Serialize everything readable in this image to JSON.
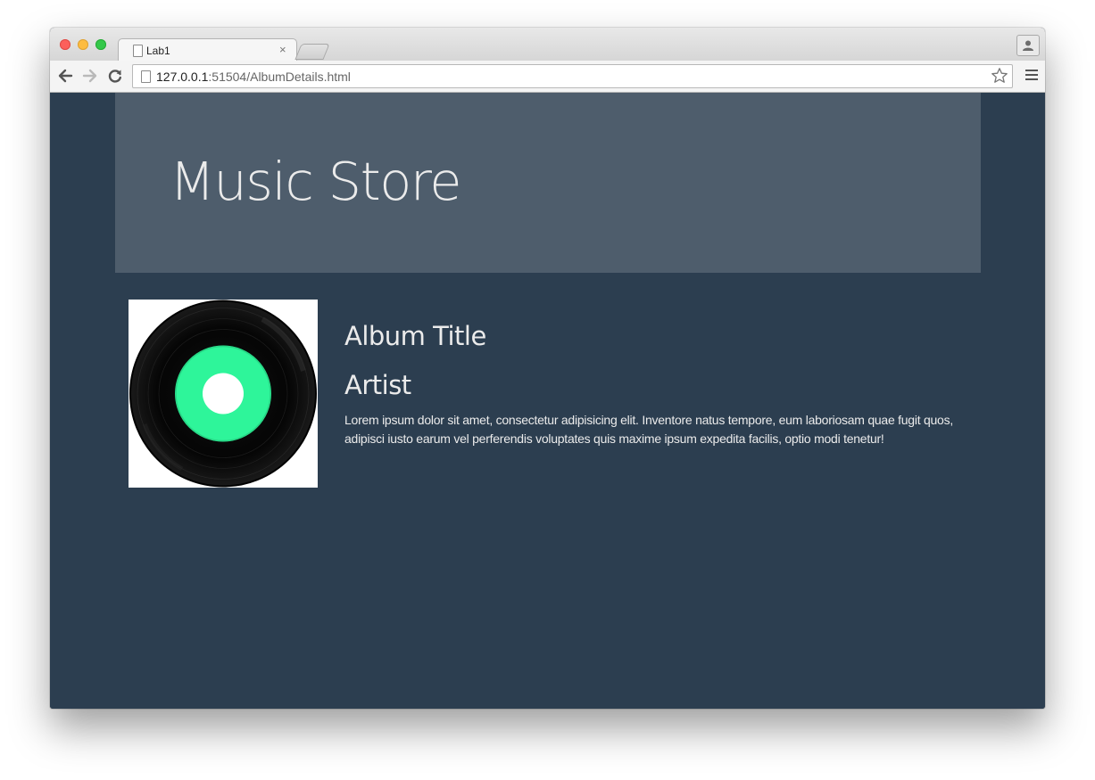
{
  "browser": {
    "tab_title": "Lab1",
    "tab_close": "×",
    "url_host": "127.0.0.1",
    "url_rest": ":51504/AlbumDetails.html"
  },
  "page": {
    "site_title": "Music Store",
    "album": {
      "title": "Album Title",
      "artist": "Artist",
      "description": "Lorem ipsum dolor sit amet, consectetur adipisicing elit. Inventore natus tempore, eum laboriosam quae fugit quos, adipisci iusto earum vel perferendis voluptates quis maxime ipsum expedita facilis, optio modi tenetur!",
      "art_icon": "vinyl-record-icon"
    }
  },
  "colors": {
    "page_bg": "#2c3e50",
    "jumbotron_bg": "#4e5d6c",
    "text": "#ebebeb",
    "record_label": "#2ef59a"
  }
}
